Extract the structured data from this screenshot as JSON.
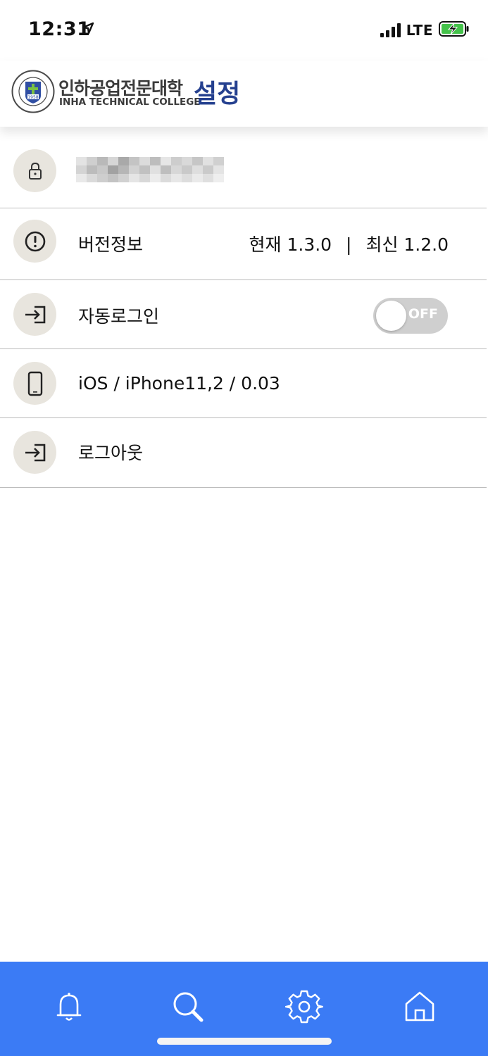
{
  "status_bar": {
    "time": "12:31",
    "network": "LTE",
    "icons": [
      "location-arrow-icon",
      "signal-icon",
      "battery-charging-icon"
    ]
  },
  "header": {
    "logo_korean": "인하공업전문대학",
    "logo_english": "INHA TECHNICAL COLLEGE",
    "logo_seal_year": "1958",
    "title": "설정"
  },
  "settings": {
    "account": {
      "icon": "lock-icon",
      "value_blurred": true
    },
    "version": {
      "icon": "info-icon",
      "label": "버전정보",
      "current": "현재 1.3.0",
      "separator": "|",
      "latest": "최신 1.2.0"
    },
    "auto_login": {
      "icon": "login-icon",
      "label": "자동로그인",
      "toggle_text": "OFF",
      "enabled": false
    },
    "device": {
      "icon": "phone-icon",
      "label": "iOS / iPhone11,2 / 0.03"
    },
    "logout": {
      "icon": "logout-icon",
      "label": "로그아웃"
    }
  },
  "bottom_nav": {
    "items": [
      {
        "icon": "bell-icon",
        "name": "notifications"
      },
      {
        "icon": "search-icon",
        "name": "search"
      },
      {
        "icon": "gear-icon",
        "name": "settings"
      },
      {
        "icon": "home-icon",
        "name": "home"
      }
    ]
  },
  "colors": {
    "title": "#25408f",
    "nav_background": "#3b7bf5",
    "icon_circle": "#e8e5de",
    "divider": "#bdbdbd",
    "toggle_off": "#cfcfcf",
    "battery_charge": "#44c24a"
  }
}
